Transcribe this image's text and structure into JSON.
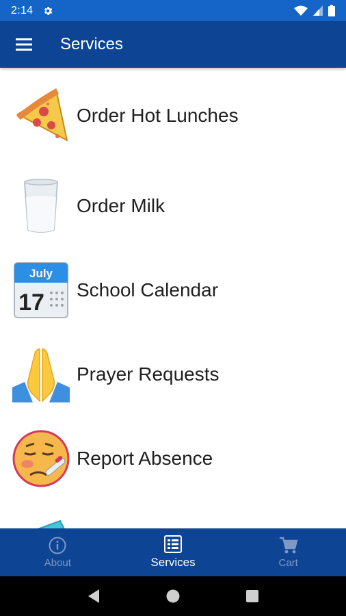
{
  "status_bar": {
    "time": "2:14"
  },
  "app_bar": {
    "title": "Services"
  },
  "services": [
    {
      "label": "Order Hot Lunches",
      "icon": "pizza-icon"
    },
    {
      "label": "Order Milk",
      "icon": "milk-glass-icon"
    },
    {
      "label": "School Calendar",
      "icon": "calendar-icon",
      "calendar_month": "July",
      "calendar_day": "17"
    },
    {
      "label": "Prayer Requests",
      "icon": "praying-hands-icon"
    },
    {
      "label": "Report Absence",
      "icon": "sick-face-icon"
    },
    {
      "label": "",
      "icon": "ticket-icon"
    }
  ],
  "bottom_nav": [
    {
      "label": "About",
      "icon": "info-icon",
      "active": false
    },
    {
      "label": "Services",
      "icon": "list-icon",
      "active": true
    },
    {
      "label": "Cart",
      "icon": "cart-icon",
      "active": false
    }
  ],
  "colors": {
    "status_bar": "#1565c8",
    "app_bar": "#0d4494",
    "inactive_nav": "#7f98c4"
  }
}
